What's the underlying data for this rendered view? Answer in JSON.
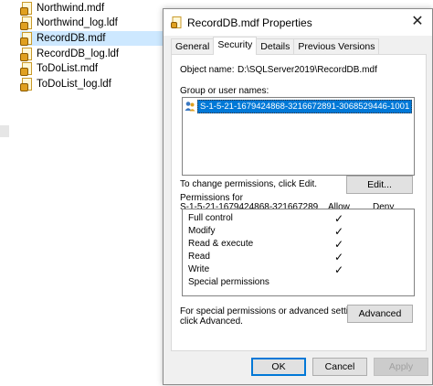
{
  "explorer": {
    "files": [
      {
        "name": "Northwind.mdf",
        "selected": false
      },
      {
        "name": "Northwind_log.ldf",
        "selected": false
      },
      {
        "name": "RecordDB.mdf",
        "selected": true
      },
      {
        "name": "RecordDB_log.ldf",
        "selected": false
      },
      {
        "name": "ToDoList.mdf",
        "selected": false
      },
      {
        "name": "ToDoList_log.ldf",
        "selected": false
      }
    ],
    "file_icon": "database-file-icon"
  },
  "dialog": {
    "title": "RecordDB.mdf Properties",
    "close_glyph": "✕",
    "tabs": [
      {
        "label": "General",
        "active": false
      },
      {
        "label": "Security",
        "active": true
      },
      {
        "label": "Details",
        "active": false
      },
      {
        "label": "Previous Versions",
        "active": false
      }
    ],
    "object_name_label": "Object name:",
    "object_name_value": "D:\\SQLServer2019\\RecordDB.mdf",
    "group_label": "Group or user names:",
    "users": [
      {
        "name": "S-1-5-21-1679424868-3216672891-3068529446-1001",
        "selected": true,
        "icon": "user-group-icon"
      }
    ],
    "change_text": "To change permissions, click Edit.",
    "edit_button": "Edit...",
    "permissions_for_label": "Permissions for",
    "permissions_for_name": "S-1-5-21-1679424868-321667289",
    "allow_header": "Allow",
    "deny_header": "Deny",
    "permissions": [
      {
        "name": "Full control",
        "allow": "✓",
        "deny": ""
      },
      {
        "name": "Modify",
        "allow": "✓",
        "deny": ""
      },
      {
        "name": "Read & execute",
        "allow": "✓",
        "deny": ""
      },
      {
        "name": "Read",
        "allow": "✓",
        "deny": ""
      },
      {
        "name": "Write",
        "allow": "✓",
        "deny": ""
      },
      {
        "name": "Special permissions",
        "allow": "",
        "deny": ""
      }
    ],
    "advanced_text_line1": "For special permissions or advanced settings,",
    "advanced_text_line2": "click Advanced.",
    "advanced_button": "Advanced",
    "ok_button": "OK",
    "cancel_button": "Cancel",
    "apply_button": "Apply",
    "colors": {
      "accent": "#0078d7",
      "selection": "#cde8ff",
      "face": "#f0f0f0"
    }
  }
}
